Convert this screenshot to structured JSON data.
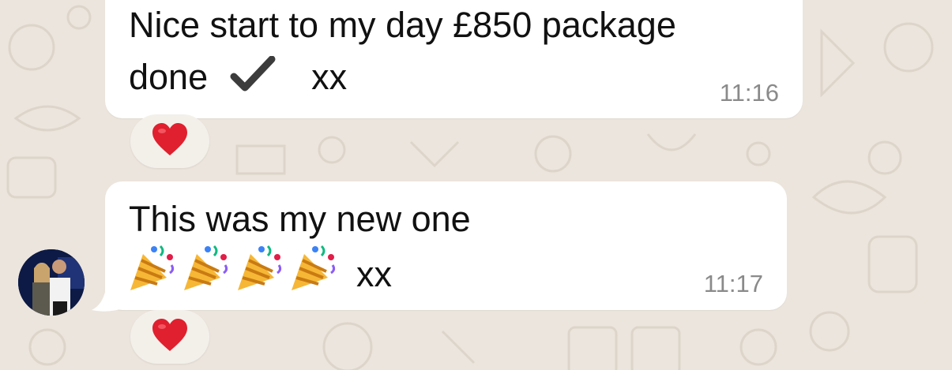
{
  "messages": [
    {
      "line1": "Nice start  to my day £850 package",
      "line2_prefix": "done",
      "check_icon": "heavy-check-mark",
      "line2_suffix": "xx",
      "time": "11:16",
      "reaction": "red-heart"
    },
    {
      "line1": "This was my new one",
      "emoji": [
        "party-popper",
        "party-popper",
        "party-popper",
        "party-popper"
      ],
      "line2_suffix": "xx",
      "time": "11:17",
      "reaction": "red-heart"
    }
  ],
  "colors": {
    "background": "#ece5dd",
    "bubble": "#ffffff",
    "text": "#111111",
    "timestamp": "#8a8a8a",
    "heart": "#e0202e"
  }
}
